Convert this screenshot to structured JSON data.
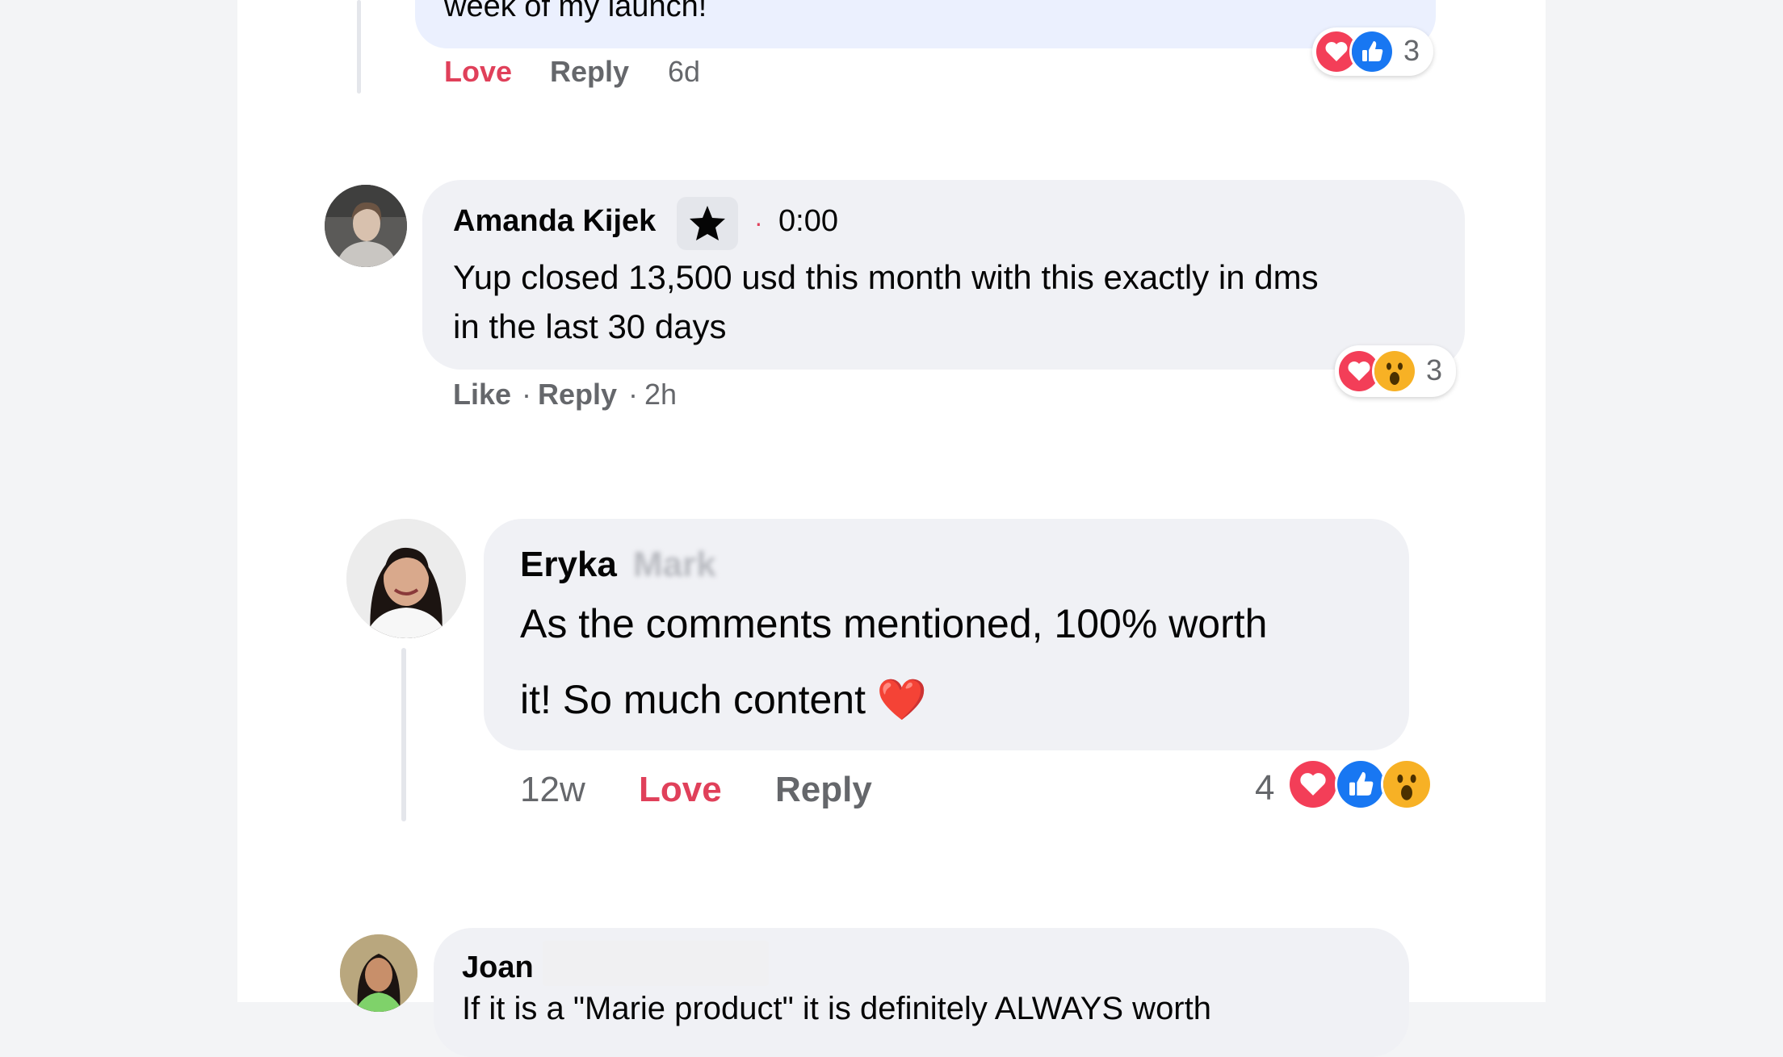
{
  "comment_top": {
    "text_tail": "week of my launch!",
    "actions": {
      "love": "Love",
      "reply": "Reply",
      "time": "6d"
    },
    "reactions": {
      "icons": [
        "heart-icon",
        "like-icon"
      ],
      "count": "3"
    }
  },
  "comment_amanda": {
    "author": "Amanda Kijek",
    "badge_icon": "star-icon",
    "sep": "·",
    "time_code": "0:00",
    "lines": [
      "Yup closed 13,500 usd this month with this exactly in dms",
      "in the last 30 days"
    ],
    "actions": {
      "like": "Like",
      "dot1": "·",
      "reply": "Reply",
      "dot2": "·",
      "time": "2h"
    },
    "reactions": {
      "icons": [
        "heart-icon",
        "wow-icon"
      ],
      "count": "3"
    }
  },
  "comment_eryka": {
    "author": "Eryka",
    "author_blurred": "Mark",
    "lines": [
      "As the comments mentioned, 100% worth",
      "it! So much content ❤️"
    ],
    "actions": {
      "time": "12w",
      "love": "Love",
      "reply": "Reply"
    },
    "reactions": {
      "count": "4",
      "icons": [
        "heart-icon",
        "like-icon",
        "wow-icon"
      ]
    }
  },
  "comment_joan": {
    "author": "Joan",
    "text_partial": "If it is a \"Marie product\" it is definitely ALWAYS worth"
  },
  "colors": {
    "love": "#e0405a",
    "bubble": "#f0f1f5",
    "like_blue": "#1877f2",
    "heart_red": "#f33e58",
    "wow_yellow": "#f7b125"
  }
}
